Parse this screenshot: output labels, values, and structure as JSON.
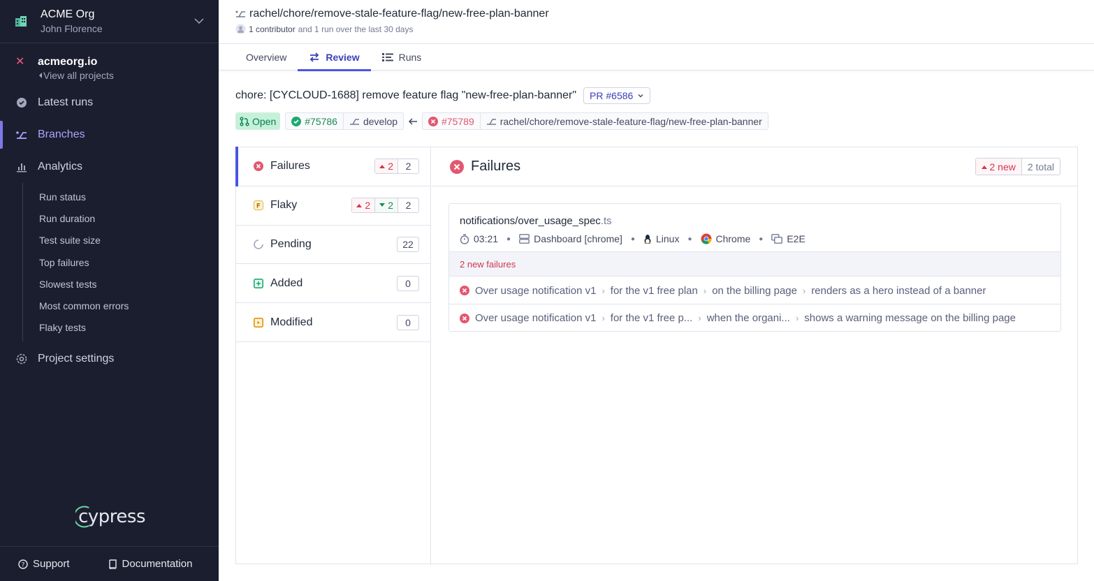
{
  "org": {
    "name": "ACME Org",
    "user": "John Florence"
  },
  "project": {
    "name": "acmeorg.io",
    "back_label": "View all projects"
  },
  "nav": {
    "latest_runs": "Latest runs",
    "branches": "Branches",
    "analytics": "Analytics",
    "analytics_items": [
      "Run status",
      "Run duration",
      "Test suite size",
      "Top failures",
      "Slowest tests",
      "Most common errors",
      "Flaky tests"
    ],
    "project_settings": "Project settings"
  },
  "logo_text": "cypress",
  "footer": {
    "support": "Support",
    "documentation": "Documentation"
  },
  "header": {
    "branch": "rachel/chore/remove-stale-feature-flag/new-free-plan-banner",
    "contributors": "1 contributor",
    "runs_summary": "and 1 run over the last 30 days"
  },
  "tabs": {
    "overview": "Overview",
    "review": "Review",
    "runs": "Runs"
  },
  "pr": {
    "title": "chore: [CYCLOUD-1688] remove feature flag \"new-free-plan-banner\"",
    "number_label": "PR #6586",
    "status": "Open",
    "base_run": "#75786",
    "base_branch": "develop",
    "head_run": "#75789",
    "head_branch": "rachel/chore/remove-stale-feature-flag/new-free-plan-banner"
  },
  "categories": {
    "failures": {
      "label": "Failures",
      "new": "2",
      "total": "2"
    },
    "flaky": {
      "label": "Flaky",
      "new": "2",
      "resolved": "2",
      "total": "2"
    },
    "pending": {
      "label": "Pending",
      "total": "22"
    },
    "added": {
      "label": "Added",
      "total": "0"
    },
    "modified": {
      "label": "Modified",
      "total": "0"
    }
  },
  "detail": {
    "title": "Failures",
    "new_count": "2 new",
    "total_count": "2 total",
    "spec": {
      "name": "notifications/over_usage_spec",
      "ext": ".ts",
      "duration": "03:21",
      "group": "Dashboard [chrome]",
      "os": "Linux",
      "browser": "Chrome",
      "testing_type": "E2E"
    },
    "new_failures_label": "2 new failures",
    "tests": [
      {
        "crumbs": [
          "Over usage notification v1",
          "for the v1 free plan",
          "on the billing page",
          "renders as a hero instead of a banner"
        ]
      },
      {
        "crumbs": [
          "Over usage notification v1",
          "for the v1 free p...",
          "when the organi...",
          "shows a warning message on the billing page"
        ]
      }
    ]
  },
  "colors": {
    "sidebar_bg": "#1b1e2e",
    "accent": "#4956e3",
    "failure": "#e45770",
    "success": "#1c8a55"
  }
}
